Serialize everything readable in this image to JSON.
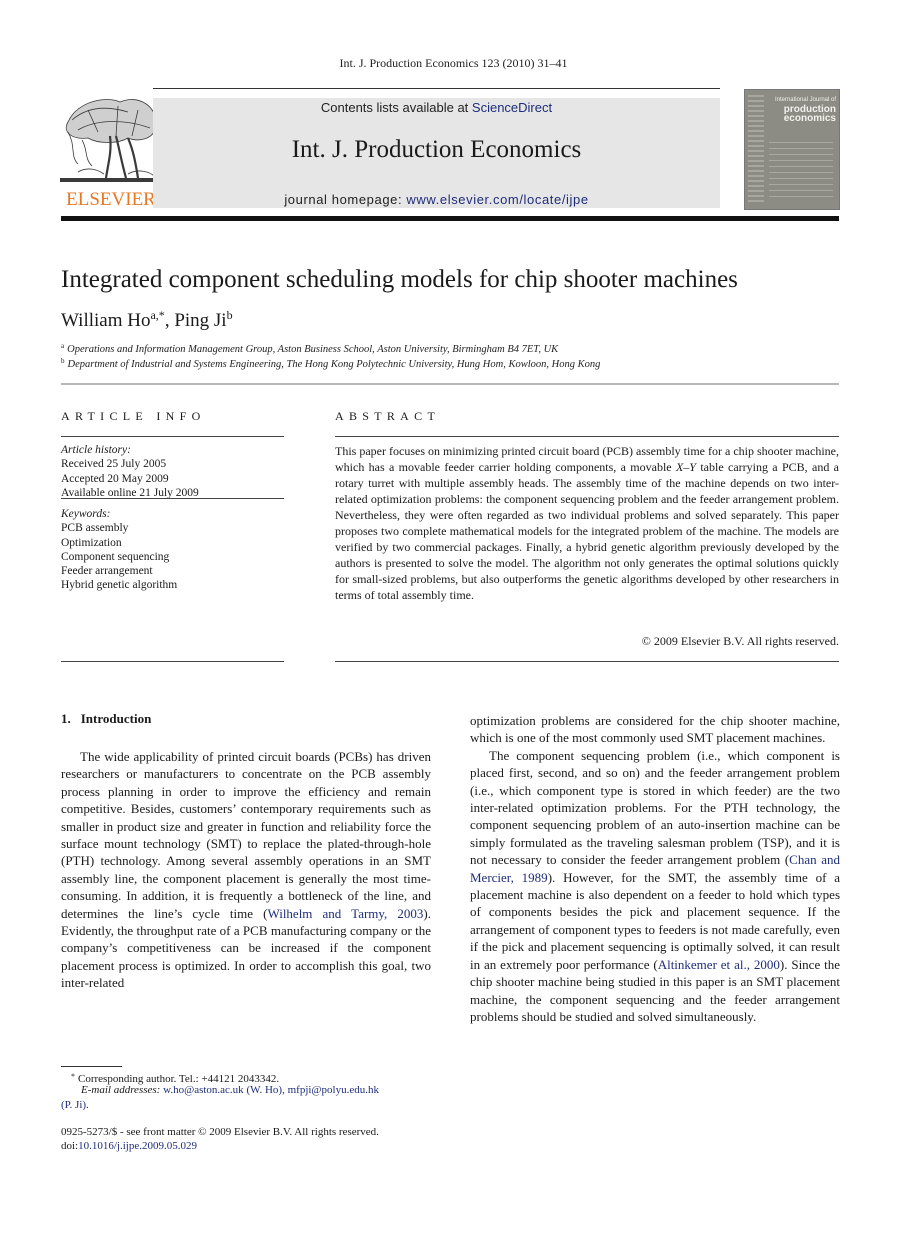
{
  "running_head": "Int. J. Production Economics 123 (2010) 31–41",
  "masthead": {
    "publisher_logo_text": "ELSEVIER",
    "contents_prefix": "Contents lists available at ",
    "contents_link": "ScienceDirect",
    "journal_title": "Int. J. Production Economics",
    "homepage_prefix": "journal homepage: ",
    "homepage_link": "www.elsevier.com/locate/ijpe",
    "cover": {
      "line1": "International Journal of",
      "line2": "production",
      "line3": "economics"
    }
  },
  "article": {
    "title": "Integrated component scheduling models for chip shooter machines",
    "authors": [
      {
        "name": "William Ho",
        "marks": "a,*"
      },
      {
        "name": "Ping Ji",
        "marks": "b"
      }
    ],
    "author_separator": ", ",
    "affiliations": [
      {
        "mark": "a",
        "text": "Operations and Information Management Group, Aston Business School, Aston University, Birmingham B4 7ET, UK"
      },
      {
        "mark": "b",
        "text": "Department of Industrial and Systems Engineering, The Hong Kong Polytechnic University, Hung Hom, Kowloon, Hong Kong"
      }
    ]
  },
  "article_info": {
    "heading": "ARTICLE INFO",
    "history_label": "Article history:",
    "history": [
      "Received 25 July 2005",
      "Accepted 20 May 2009",
      "Available online 21 July 2009"
    ],
    "keywords_label": "Keywords:",
    "keywords": [
      "PCB assembly",
      "Optimization",
      "Component sequencing",
      "Feeder arrangement",
      "Hybrid genetic algorithm"
    ]
  },
  "abstract": {
    "heading": "ABSTRACT",
    "part1": "This paper focuses on minimizing printed circuit board (PCB) assembly time for a chip shooter machine, which has a movable feeder carrier holding components, a movable ",
    "italic": "X–Y",
    "part2": " table carrying a PCB, and a rotary turret with multiple assembly heads. The assembly time of the machine depends on two inter-related optimization problems: the component sequencing problem and the feeder arrangement problem. Nevertheless, they were often regarded as two individual problems and solved separately. This paper proposes two complete mathematical models for the integrated problem of the machine. The models are verified by two commercial packages. Finally, a hybrid genetic algorithm previously developed by the authors is presented to solve the model. The algorithm not only generates the optimal solutions quickly for small-sized problems, but also outperforms the genetic algorithms developed by other researchers in terms of total assembly time.",
    "copyright": "© 2009 Elsevier B.V. All rights reserved."
  },
  "section": {
    "number": "1.",
    "title": "Introduction"
  },
  "body": {
    "p1_a": "The wide applicability of printed circuit boards (PCBs) has driven researchers or manufacturers to concentrate on the PCB assembly process planning in order to improve the efficiency and remain competitive. Besides, customers’ contemporary requirements such as smaller in product size and greater in function and reliability force the surface mount technology (SMT) to replace the plated-through-hole (PTH) technology. Among several assembly operations in an SMT assembly line, the component placement is generally the most time-consuming. In addition, it is frequently a bottleneck of the line, and determines the line’s cycle time (",
    "p1_cite": "Wilhelm and Tarmy, 2003",
    "p1_b": "). Evidently, the throughput rate of a PCB manufacturing company or the company’s competitiveness can be increased if the component placement process is optimized. In order to accomplish this goal, two inter-related",
    "p1_cont": "optimization problems are considered for the chip shooter machine, which is one of the most commonly used SMT placement machines.",
    "p2_a": "The component sequencing problem (i.e., which component is placed first, second, and so on) and the feeder arrangement problem (i.e., which component type is stored in which feeder) are the two inter-related optimization problems. For the PTH technology, the component sequencing problem of an auto-insertion machine can be simply formulated as the traveling salesman problem (TSP), and it is not necessary to consider the feeder arrangement problem (",
    "p2_cite1": "Chan and Mercier, 1989",
    "p2_b": "). However, for the SMT, the assembly time of a placement machine is also dependent on a feeder to hold which types of components besides the pick and placement sequence. If the arrangement of component types to feeders is not made carefully, even if the pick and placement sequencing is optimally solved, it can result in an extremely poor performance (",
    "p2_cite2": "Altinkemer et al., 2000",
    "p2_c": "). Since the chip shooter machine being studied in this paper is an SMT placement machine, the component sequencing and the feeder arrangement problems should be studied and solved simultaneously."
  },
  "footnotes": {
    "corr_mark": "*",
    "corr_text": "Corresponding author. Tel.: +44121 2043342.",
    "email_label": "E-mail addresses: ",
    "email1": "w.ho@aston.ac.uk",
    "email1_who": " (W. Ho), ",
    "email2": "mfpji@polyu.edu.hk",
    "email2_who": "(P. Ji).",
    "front_matter": "0925-5273/$ - see front matter © 2009 Elsevier B.V. All rights reserved.",
    "doi_prefix": "doi:",
    "doi_link": "10.1016/j.ijpe.2009.05.029"
  },
  "colors": {
    "link": "#1e2d7a",
    "elsevier_orange": "#e87722",
    "masthead_bg": "#e6e6e6"
  }
}
